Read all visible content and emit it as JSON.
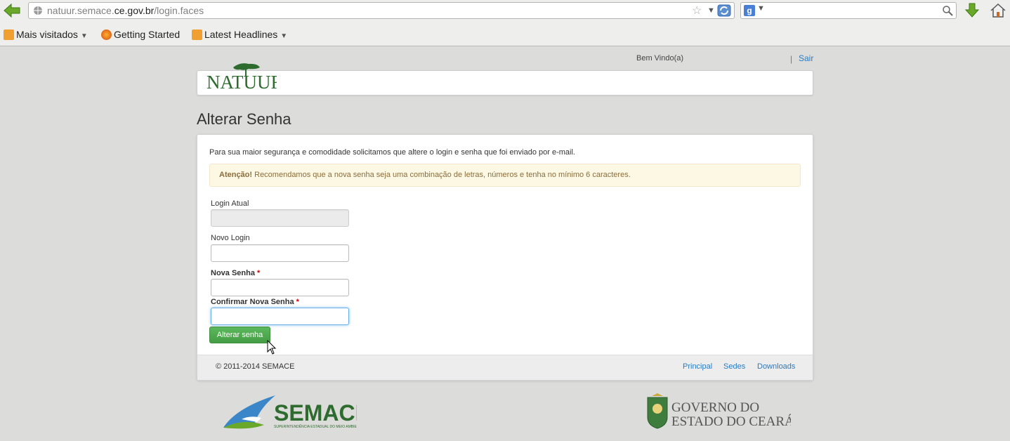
{
  "browser": {
    "url_prefix": "natuur.semace.",
    "url_domain": "ce.gov.br",
    "url_path": "/login.faces",
    "bookmarks": [
      {
        "label": "Mais visitados",
        "has_dropdown": true
      },
      {
        "label": "Getting Started",
        "has_dropdown": false
      },
      {
        "label": "Latest Headlines",
        "has_dropdown": true
      }
    ]
  },
  "header": {
    "welcome": "Bem Vindo(a)",
    "separator": "|",
    "logout": "Sair",
    "logo_text": "NATUUR"
  },
  "page": {
    "title": "Alterar Senha",
    "intro": "Para sua maior segurança e comodidade solicitamos que altere o login e senha que foi enviado por e-mail.",
    "alert_strong": "Atenção!",
    "alert_text": " Recomendamos que a nova senha seja uma combinação de letras, números e tenha no mínimo 6 caracteres."
  },
  "form": {
    "login_atual_label": "Login Atual",
    "login_atual_value": "",
    "novo_login_label": "Novo Login",
    "novo_login_value": "",
    "nova_senha_label": "Nova Senha",
    "confirmar_label": "Confirmar Nova Senha",
    "required_mark": "*",
    "submit": "Alterar senha"
  },
  "footer": {
    "copyright": "© 2011-2014 SEMACE",
    "links": [
      "Principal",
      "Sedes",
      "Downloads"
    ]
  },
  "logos": {
    "semace": "SEMACE",
    "semace_sub": "SUPERINTENDÊNCIA ESTADUAL DO MEIO AMBIENTE",
    "gov_line1": "GOVERNO DO",
    "gov_line2": "ESTADO DO CEARÁ"
  },
  "colors": {
    "link": "#2a7bc0",
    "button_green": "#5cb85c",
    "alert_bg": "#fcf8e3",
    "logo_green": "#2e6b2e"
  }
}
